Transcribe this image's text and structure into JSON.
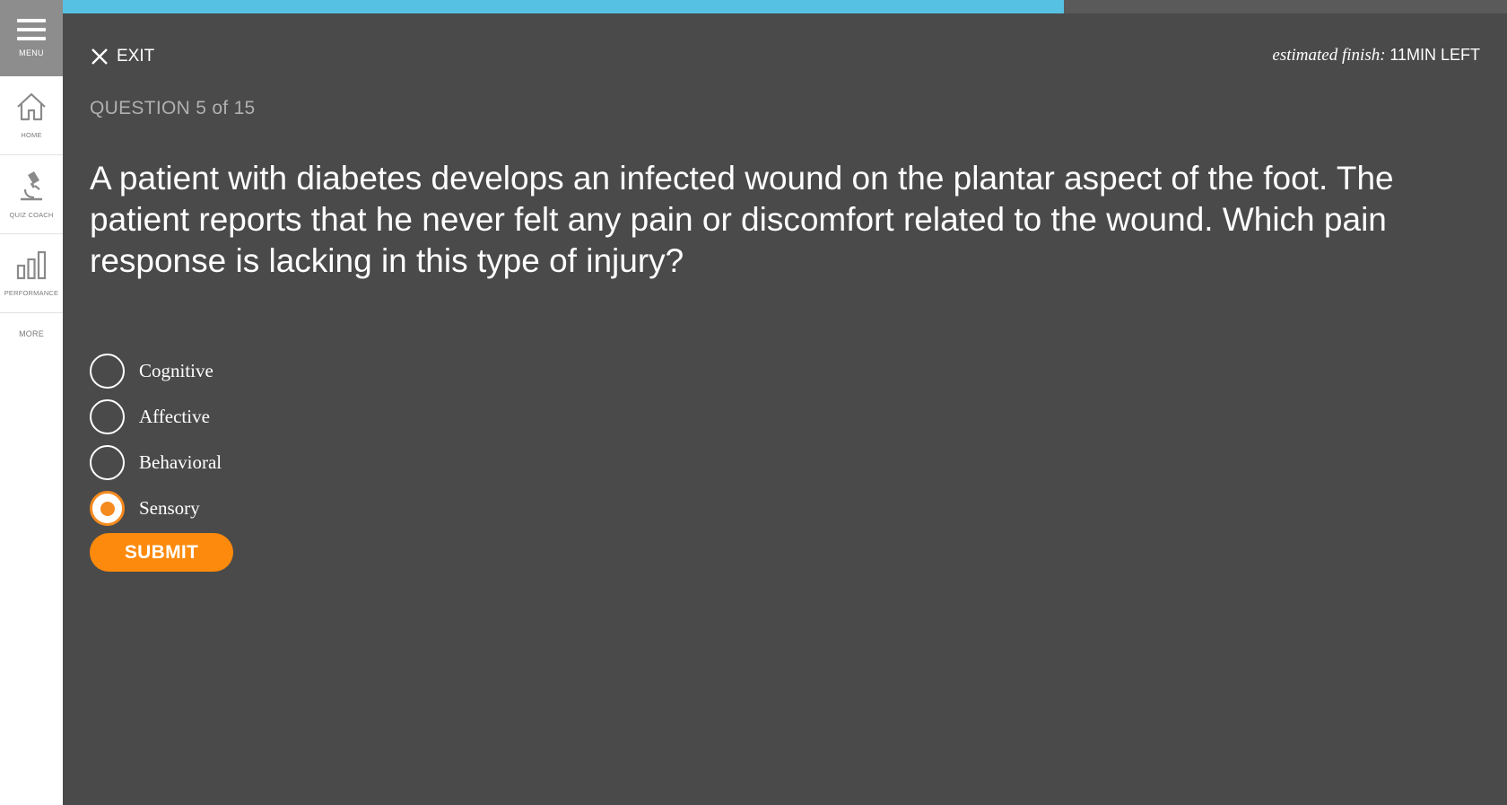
{
  "sidebar": {
    "menu_label": "MENU",
    "items": [
      {
        "label": "HOME",
        "icon": "home-icon"
      },
      {
        "label": "QUIZ COACH",
        "icon": "microscope-icon"
      },
      {
        "label": "PERFORMANCE",
        "icon": "bar-chart-icon"
      },
      {
        "label": "MORE"
      }
    ]
  },
  "progress": {
    "fraction": 0.693,
    "color": "#56c1e3"
  },
  "header": {
    "exit_label": "EXIT",
    "estimate_label": "estimated finish:",
    "estimate_value": "11MIN LEFT"
  },
  "question": {
    "counter": "QUESTION 5 of 15",
    "text": "A patient with diabetes develops an infected wound on the plantar aspect of the foot. The patient reports that he never felt any pain or discomfort related to the wound. Which pain response is lacking in this type of injury?",
    "options": [
      {
        "label": "Cognitive",
        "selected": false
      },
      {
        "label": "Affective",
        "selected": false
      },
      {
        "label": "Behavioral",
        "selected": false
      },
      {
        "label": "Sensory",
        "selected": true
      }
    ],
    "submit_label": "SUBMIT"
  },
  "colors": {
    "accent": "#fd8a0c",
    "background": "#4a4a4a",
    "progress": "#56c1e3"
  }
}
